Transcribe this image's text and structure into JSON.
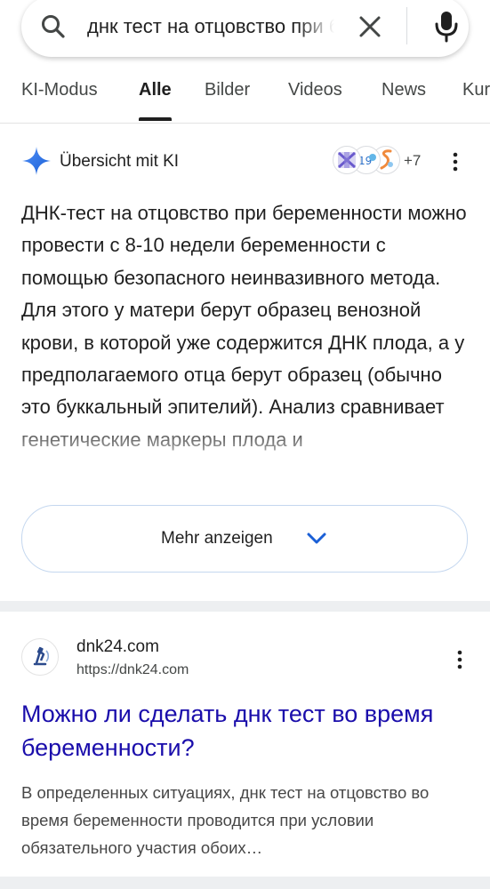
{
  "search": {
    "query": "днк тест на отцовство при беременности",
    "icon": "search-icon",
    "clear_icon": "close-icon",
    "mic_icon": "mic-icon"
  },
  "tabs": [
    {
      "label": "KI-Modus",
      "active": false
    },
    {
      "label": "Alle",
      "active": true
    },
    {
      "label": "Bilder",
      "active": false
    },
    {
      "label": "Videos",
      "active": false
    },
    {
      "label": "News",
      "active": false
    },
    {
      "label": "Kurz",
      "active": false
    }
  ],
  "ai_overview": {
    "title": "Übersicht mit KI",
    "sources_more": "+7",
    "text": "ДНК-тест на отцовство при беременности можно провести с 8-10 недели беременности с помощью безопасного неинвазивного метода. Для этого у матери берут образец венозной крови, в которой уже содержится ДНК плода, а у предполагаемого отца берут образец (обычно это буккальный эпителий). Анализ сравнивает генетические маркеры плода и",
    "show_more": "Mehr anzeigen",
    "accent_color": "#4285f4"
  },
  "result": {
    "site_name": "dnk24.com",
    "url": "https://dnk24.com",
    "title": "Можно ли сделать днк тест во время беременности?",
    "snippet": "В определенных ситуациях, днк тест на отцовство во время беременности проводится при условии обязательного участия обоих…",
    "title_color": "#1a0dab"
  }
}
